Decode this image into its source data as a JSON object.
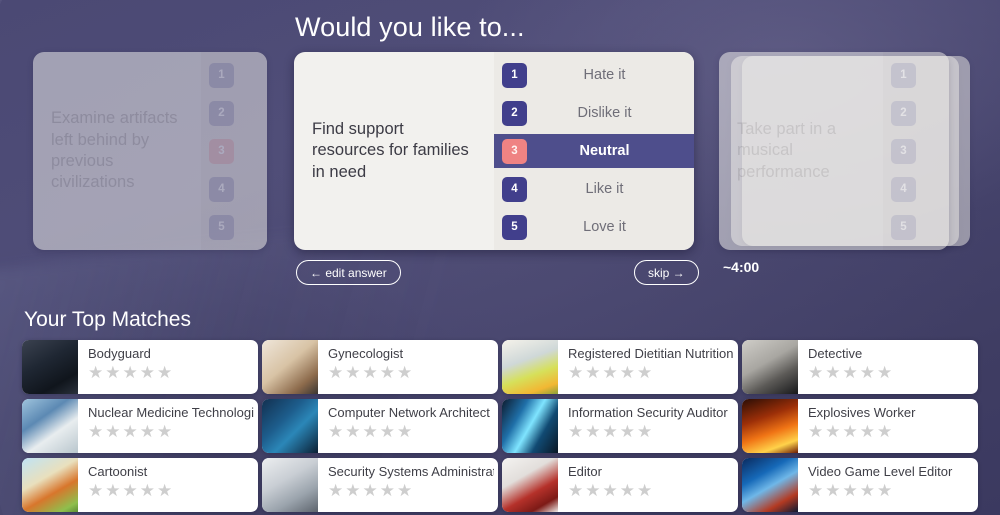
{
  "question": {
    "title": "Would you like to...",
    "previous_card": {
      "prompt": "Examine artifacts left behind by previous civilizations",
      "badges": [
        "1",
        "2",
        "3",
        "4",
        "5"
      ],
      "answered_index": 2
    },
    "current_card": {
      "prompt": "Find support resources for families in need",
      "options": [
        {
          "number": "1",
          "label": "Hate it",
          "selected": false
        },
        {
          "number": "2",
          "label": "Dislike it",
          "selected": false
        },
        {
          "number": "3",
          "label": "Neutral",
          "selected": true
        },
        {
          "number": "4",
          "label": "Like it",
          "selected": false
        },
        {
          "number": "5",
          "label": "Love it",
          "selected": false
        }
      ]
    },
    "next_card": {
      "prompt": "Take part in a musical performance",
      "badges": [
        "1",
        "2",
        "3",
        "4",
        "5"
      ]
    }
  },
  "controls": {
    "edit_answer_label": "← edit answer",
    "skip_label": "skip →",
    "time_remaining": "~4:00"
  },
  "matches": {
    "title": "Your Top Matches",
    "rating_max": 5,
    "items": [
      {
        "name": "Bodyguard",
        "rating": 0,
        "thumb": "t-bodyguard"
      },
      {
        "name": "Gynecologist",
        "rating": 0,
        "thumb": "t-gyn"
      },
      {
        "name": "Registered Dietitian Nutritionist",
        "rating": 0,
        "thumb": "t-dietitian"
      },
      {
        "name": "Detective",
        "rating": 0,
        "thumb": "t-detective"
      },
      {
        "name": "Nuclear Medicine Technologist",
        "rating": 0,
        "thumb": "t-nuclear"
      },
      {
        "name": "Computer Network Architect",
        "rating": 0,
        "thumb": "t-network"
      },
      {
        "name": "Information Security Auditor",
        "rating": 0,
        "thumb": "t-infosec"
      },
      {
        "name": "Explosives Worker",
        "rating": 0,
        "thumb": "t-explosives"
      },
      {
        "name": "Cartoonist",
        "rating": 0,
        "thumb": "t-cartoonist"
      },
      {
        "name": "Security Systems Administrator",
        "rating": 0,
        "thumb": "t-secsys"
      },
      {
        "name": "Editor",
        "rating": 0,
        "thumb": "t-editor"
      },
      {
        "name": "Video Game Level Editor",
        "rating": 0,
        "thumb": "t-gamelevel"
      }
    ]
  },
  "colors": {
    "background": "#4a4870",
    "card_surface": "#f2f1ee",
    "option_panel": "#eceae6",
    "badge": "#413f8c",
    "selected_row": "#4e4e8c",
    "selected_badge": "#ef8383",
    "star_empty": "#cecece",
    "text_on_dark": "#ffffff"
  }
}
